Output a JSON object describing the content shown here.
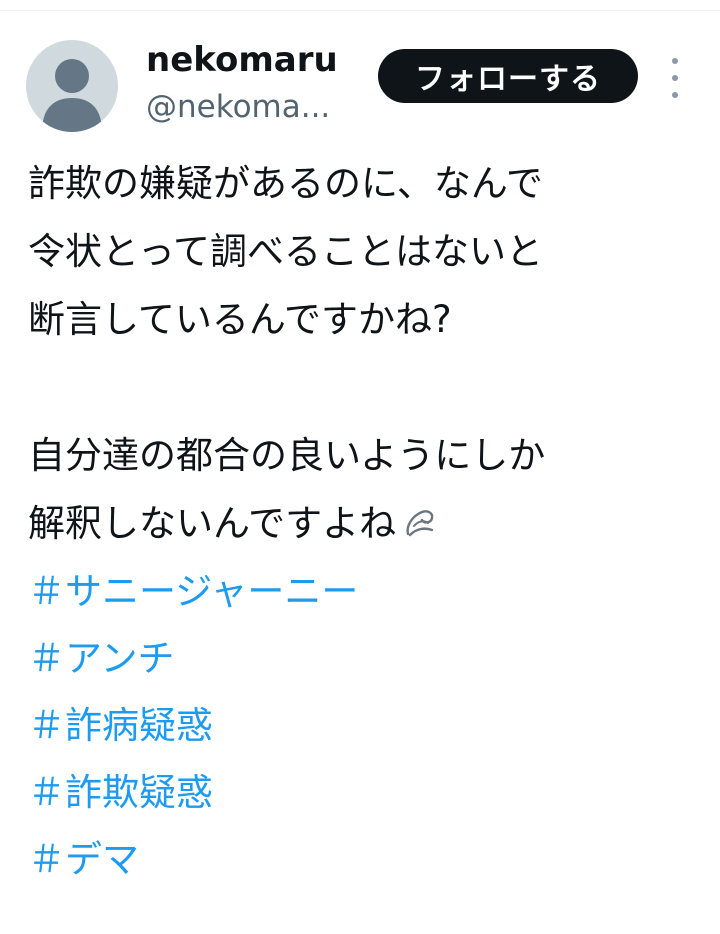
{
  "tweet": {
    "author": {
      "display_name": "nekomaru",
      "handle": "@nekoma..."
    },
    "follow_label": "フォローする",
    "more_icon": "more-vertical-icon",
    "paragraph1": [
      "詐欺の嫌疑があるのに、なんで",
      "令状とって調べることはないと",
      "断言しているんですかね?"
    ],
    "paragraph2": [
      "自分達の都合の良いようにしか",
      "解釈しないんですよね"
    ],
    "paragraph2_emoji": "dashing-away-icon",
    "hashtags": [
      "＃サニージャーニー",
      "＃アンチ",
      "＃詐病疑惑",
      "＃詐欺疑惑",
      "＃デマ"
    ]
  },
  "colors": {
    "text": "#0f1419",
    "secondary_text": "#536471",
    "link": "#1d9bf0",
    "button_bg": "#0f1419",
    "button_text": "#ffffff",
    "avatar_bg": "#cfd9de",
    "avatar_fg": "#657786"
  }
}
